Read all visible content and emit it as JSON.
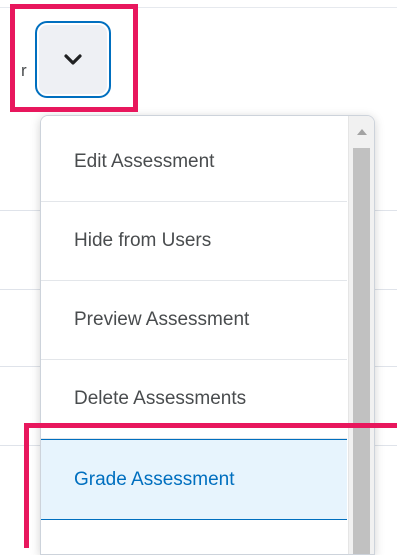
{
  "background": {
    "cut_text": "r"
  },
  "actions_button": {
    "icon": "chevron-down-icon"
  },
  "menu": {
    "items": [
      {
        "label": "Edit Assessment"
      },
      {
        "label": "Hide from Users"
      },
      {
        "label": "Preview Assessment"
      },
      {
        "label": "Delete Assessments"
      },
      {
        "label": "Grade Assessment",
        "selected": true
      }
    ],
    "scrollbar": {
      "up_icon": "scroll-up-arrow-icon"
    }
  },
  "colors": {
    "highlight": "#e8175d",
    "accent": "#006fbf",
    "selected_background": "#e7f4fd",
    "text": "#494c4e"
  }
}
